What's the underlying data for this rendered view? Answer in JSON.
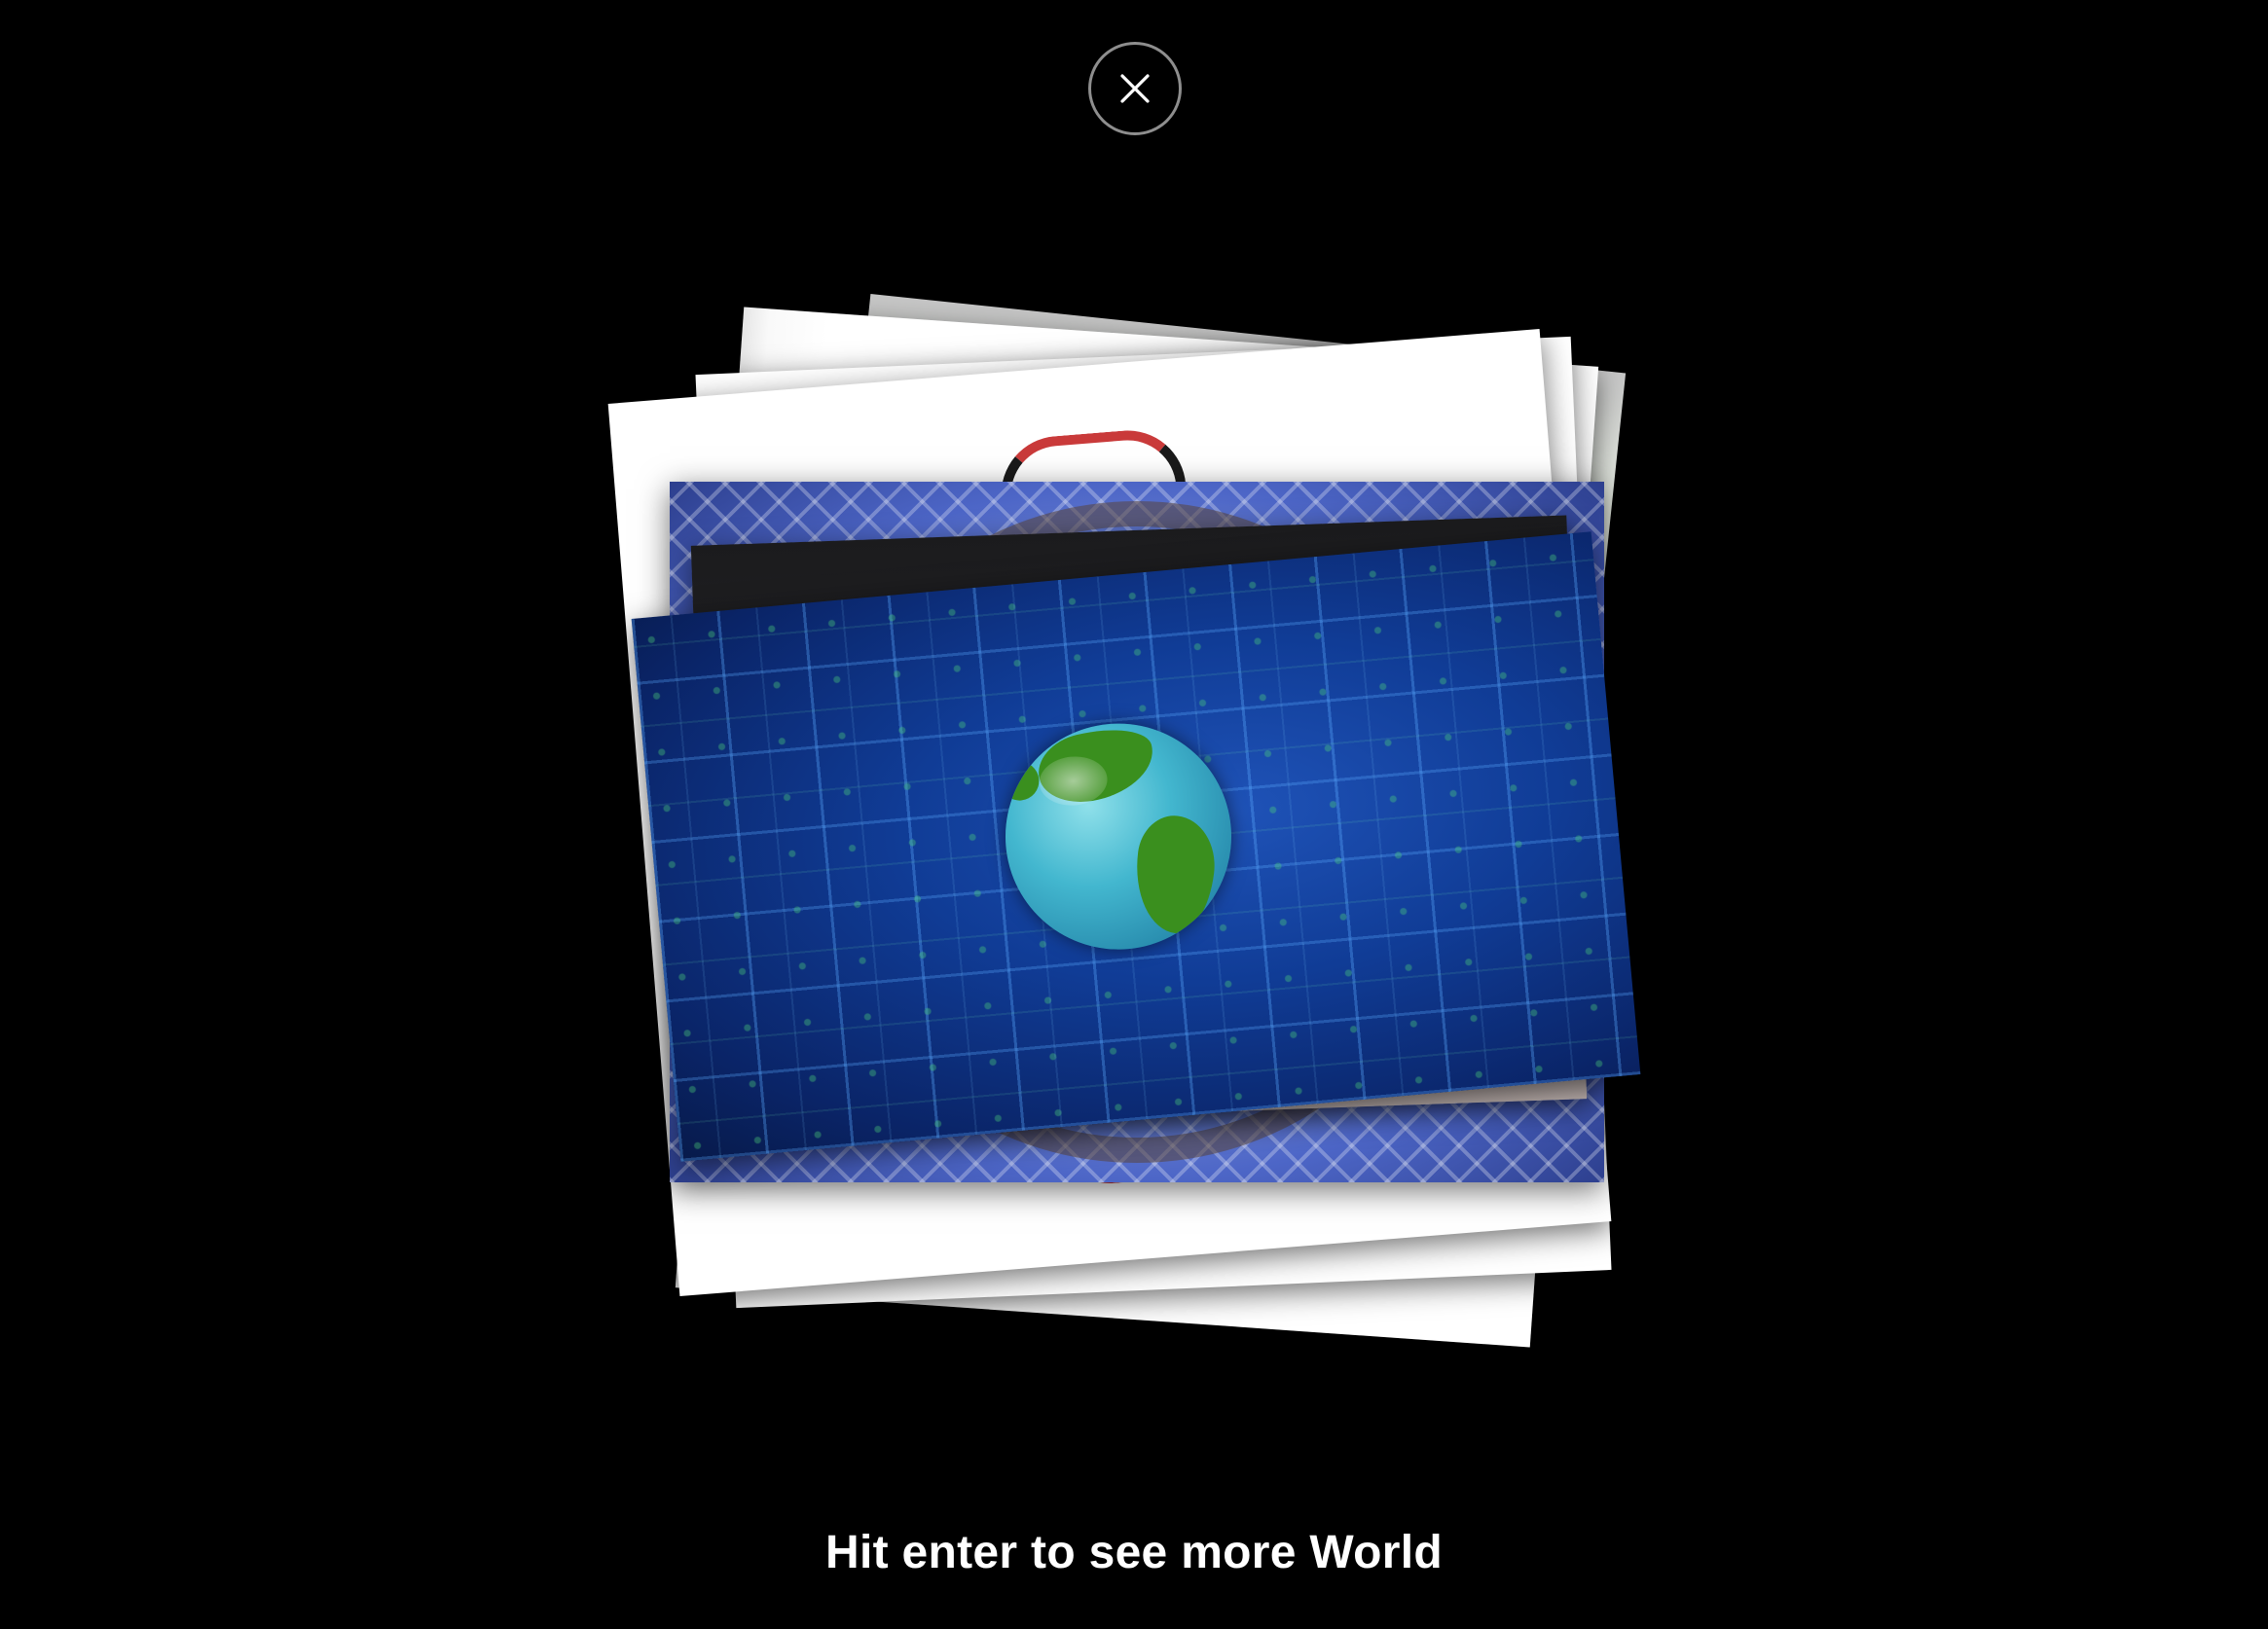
{
  "close_button": {
    "label": "Close",
    "icon": "close-icon"
  },
  "stack": {
    "topic": "World",
    "front_image": "spinning-globe-on-blue-grid",
    "cards": [
      "white-card-back",
      "white-card-tilted",
      "white-card-emblem",
      "blue-mesh-card",
      "dark-card",
      "globe-card-front"
    ]
  },
  "hint": {
    "text": "Hit enter to see more World"
  },
  "colors": {
    "background": "#000000",
    "text": "#ffffff",
    "close_border": "#8e8e8e",
    "accent_blue": "#103c96",
    "globe_land": "#3a8f1e"
  }
}
